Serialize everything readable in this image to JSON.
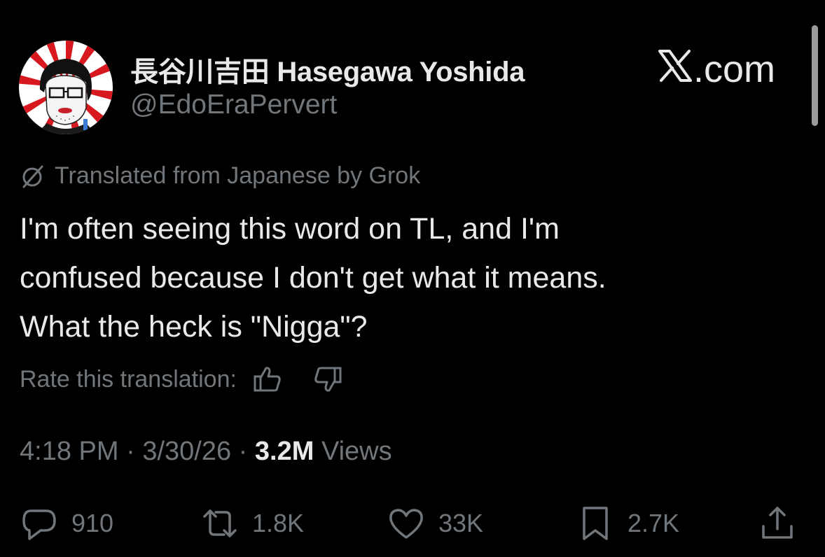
{
  "tweet": {
    "display_name": "長谷川吉田 Hasegawa Yoshida",
    "handle": "@EdoEraPervert",
    "translated_note": "Translated from Japanese by Grok",
    "text_lines": [
      "I'm often seeing this word on TL, and I'm",
      "confused because I don't get what it means.",
      "What the heck is \"Nigga\"?"
    ],
    "rate_label": "Rate this translation:",
    "time": "4:18 PM",
    "date": "3/30/26",
    "views_count": "3.2M",
    "views_label": "Views"
  },
  "brand": {
    "text": ".com"
  },
  "actions": {
    "replies": "910",
    "reposts": "1.8K",
    "likes": "33K",
    "bookmarks": "2.7K"
  },
  "icons": {
    "translate": "grok-slash-circle-icon",
    "thumbs_up": "thumbs-up-icon",
    "thumbs_down": "thumbs-down-icon",
    "reply": "reply-bubble-icon",
    "repost": "repost-arrows-icon",
    "like": "heart-icon",
    "bookmark": "bookmark-icon",
    "share": "share-upload-icon"
  },
  "colors": {
    "background": "#000000",
    "primary_text": "#e7e9ea",
    "secondary_text": "#71767b",
    "avatar_red": "#d7191f"
  }
}
